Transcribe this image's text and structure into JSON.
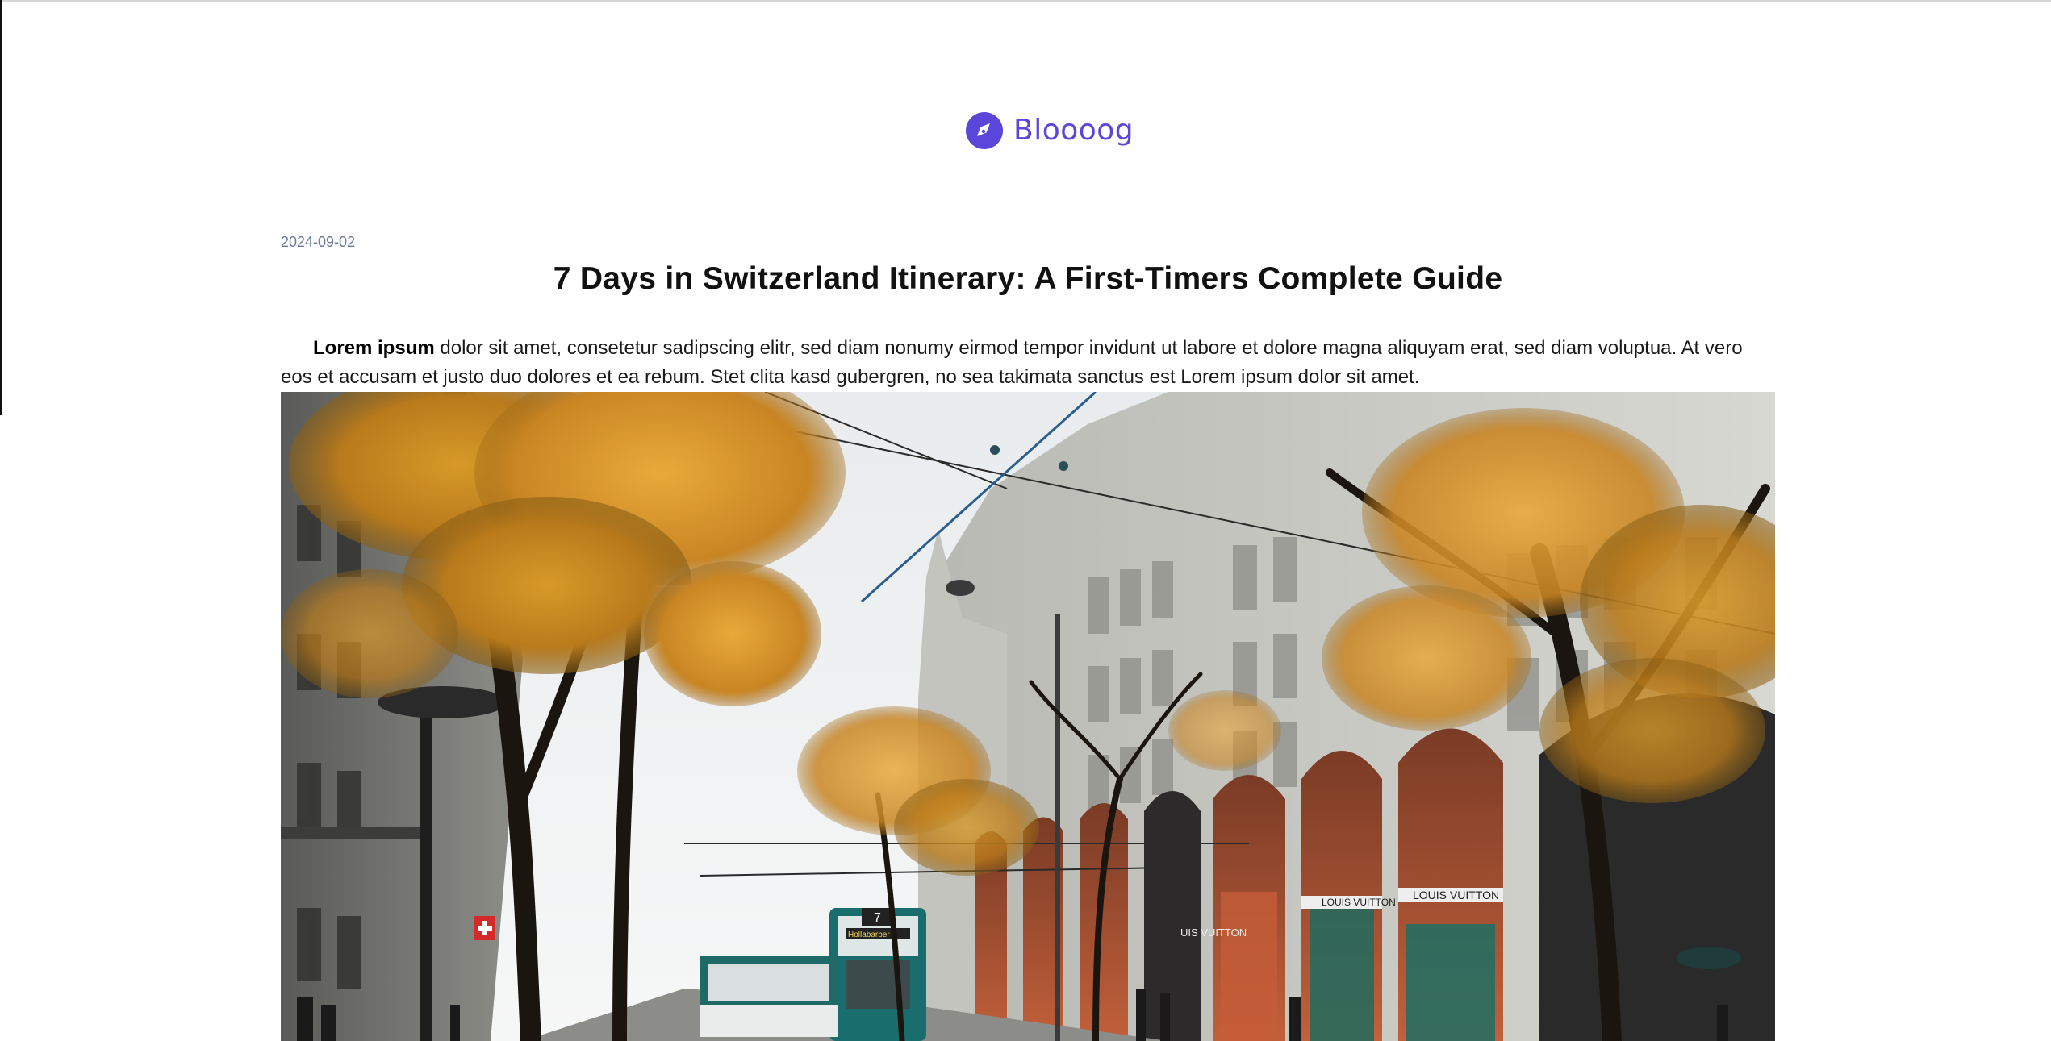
{
  "brand": {
    "name": "Bloooog",
    "logo_icon": "compass-icon",
    "accent_color": "#5b46dc"
  },
  "post": {
    "date": "2024-09-02",
    "title": "7 Days in Switzerland Itinerary: A First-Timers Complete Guide",
    "lead_bold": "Lorem ipsum",
    "lead_text": " dolor sit amet, consetetur sadipscing elitr, sed diam nonumy eirmod tempor invidunt ut labore et dolore magna aliquyam erat, sed diam voluptua. At vero eos et accusam et justo duo dolores et ea rebum. Stet clita kasd gubergren, no sea takimata sanctus est Lorem ipsum dolor sit amet.",
    "hero": {
      "tram_number": "7",
      "tram_destination": "Hollabarber",
      "store_sign_1": "LOUIS VUITTON",
      "store_sign_2": "LOUIS VUITTON",
      "store_sign_3": "UIS VUITTON"
    }
  }
}
